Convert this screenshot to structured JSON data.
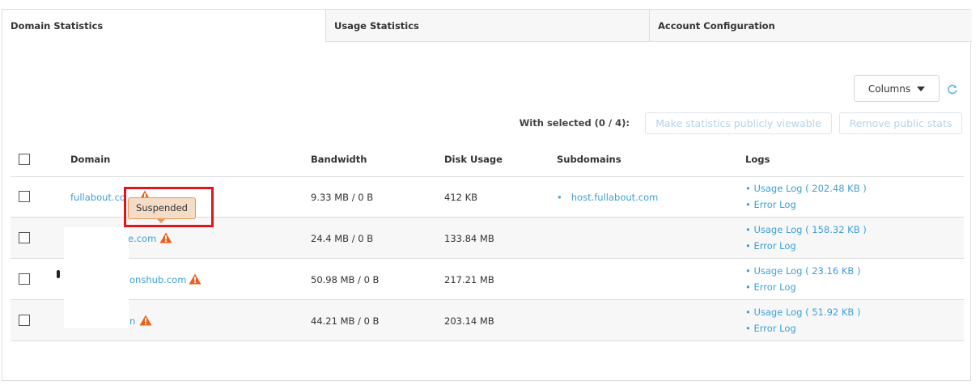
{
  "tabs": [
    {
      "label": "Domain Statistics"
    },
    {
      "label": "Usage Statistics"
    },
    {
      "label": "Account Configuration"
    }
  ],
  "toolbar": {
    "columns_label": "Columns",
    "with_selected": "With selected (0 / 4):",
    "make_public_label": "Make statistics publicly viewable",
    "remove_public_label": "Remove public stats"
  },
  "table": {
    "headers": {
      "domain": "Domain",
      "bandwidth": "Bandwidth",
      "disk": "Disk Usage",
      "subdomains": "Subdomains",
      "logs": "Logs"
    },
    "rows": [
      {
        "domain": "fullabout.co",
        "bandwidth": "9.33 MB / 0 B",
        "disk": "412 KB",
        "subdomain": "host.fullabout.com",
        "usage_log": "Usage Log ( 202.48 KB )",
        "error_log": "Error Log"
      },
      {
        "domain": "e.com",
        "bandwidth": "24.4 MB / 0 B",
        "disk": "133.84 MB",
        "subdomain": "",
        "usage_log": "Usage Log ( 158.32 KB )",
        "error_log": "Error Log"
      },
      {
        "domain": "onshub.com",
        "bandwidth": "50.98 MB / 0 B",
        "disk": "217.21 MB",
        "subdomain": "",
        "usage_log": "Usage Log ( 23.16 KB )",
        "error_log": "Error Log"
      },
      {
        "domain": "n",
        "bandwidth": "44.21 MB / 0 B",
        "disk": "203.14 MB",
        "subdomain": "",
        "usage_log": "Usage Log ( 51.92 KB )",
        "error_log": "Error Log"
      }
    ]
  },
  "tooltip": {
    "text": "Suspended"
  },
  "colors": {
    "link": "#3f9fd6",
    "warning": "#e8621f",
    "highlight": "#e2141c"
  },
  "icons": {
    "warning": "warning-triangle-icon",
    "refresh": "refresh-icon",
    "caret": "caret-down-icon",
    "bullet": "bullet-icon"
  }
}
